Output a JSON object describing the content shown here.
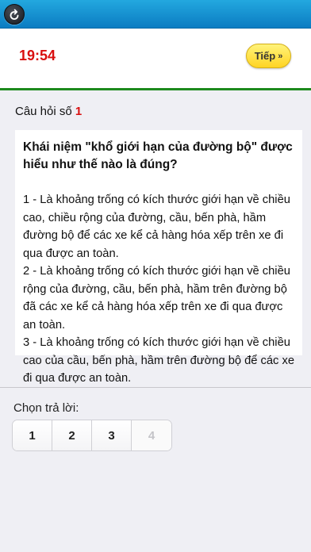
{
  "navbar": {
    "back_icon": "back-arrow-icon"
  },
  "header": {
    "timer": "19:54",
    "next_label": "Tiếp",
    "next_chevron": "»"
  },
  "question": {
    "label": "Câu hỏi số",
    "number": "1",
    "title": "Khái niệm \"khổ giới hạn của đường bộ\" được hiểu như thế nào là đúng?",
    "body": "1 - Là khoảng trống có kích thước giới hạn về chiều cao, chiều rộng của đường, cầu, bến phà, hầm đường bộ để các xe kể cả hàng hóa xếp trên xe đi qua được an toàn.\n2 - Là khoảng trống có kích thước giới hạn về chiều rộng của đường, cầu, bến phà, hầm trên đường bộ đã các xe kể cả hàng hóa xếp trên xe đi qua được an toàn.\n3 - Là khoảng trống có kích thước giới hạn về chiều cao của cầu, bến phà, hầm trên đường bộ để các xe đi qua được an toàn."
  },
  "answers": {
    "label": "Chọn trả lời:",
    "options": [
      "1",
      "2",
      "3",
      "4"
    ]
  }
}
